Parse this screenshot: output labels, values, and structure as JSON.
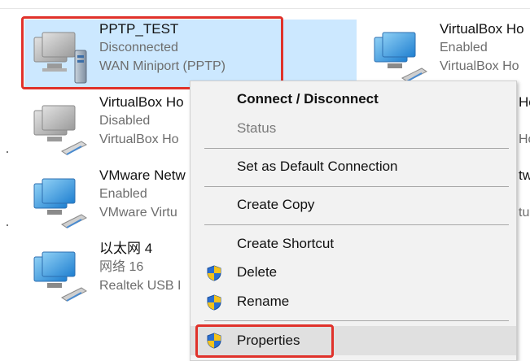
{
  "connections": [
    {
      "name": "PPTP_TEST",
      "status": "Disconnected",
      "device": "WAN Miniport (PPTP)"
    },
    {
      "name": "VirtualBox Ho",
      "status": "Enabled",
      "device": "VirtualBox Ho"
    },
    {
      "name": "VirtualBox Ho",
      "status": "Disabled",
      "device": "VirtualBox Ho"
    },
    {
      "name": "VMware Netw",
      "status": "Enabled",
      "device": "VMware Virtu"
    },
    {
      "name": "以太网 4",
      "status": "网络 16",
      "device": "Realtek USB I"
    }
  ],
  "right_partials": [
    "Ho",
    "Ho",
    "tw",
    "tu"
  ],
  "context_menu": {
    "items": [
      {
        "label": "Connect / Disconnect"
      },
      {
        "label": "Status"
      },
      {
        "label": "Set as Default Connection"
      },
      {
        "label": "Create Copy"
      },
      {
        "label": "Create Shortcut"
      },
      {
        "label": "Delete",
        "icon": "shield-icon"
      },
      {
        "label": "Rename",
        "icon": "shield-icon"
      },
      {
        "label": "Properties",
        "icon": "shield-icon"
      }
    ]
  }
}
